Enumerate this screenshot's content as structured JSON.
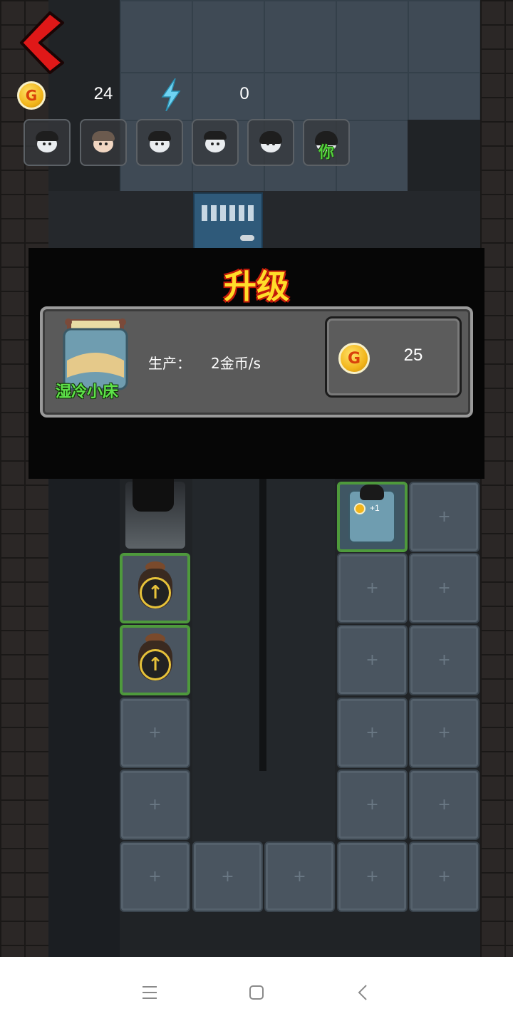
{
  "hud": {
    "gold": "24",
    "energy": "0",
    "coin_symbol": "G",
    "characters": [
      {
        "icon": "ghost-girl-icon"
      },
      {
        "icon": "old-woman-icon"
      },
      {
        "icon": "ghost-girl-icon"
      },
      {
        "icon": "boy-icon"
      },
      {
        "icon": "girl-icon"
      },
      {
        "icon": "player-girl-icon",
        "label": "你"
      }
    ]
  },
  "upgrade": {
    "title": "升级",
    "item_name": "湿冷小床",
    "produce_label": "生产：",
    "produce_value": "2金币/s",
    "cost": "25",
    "coin_symbol": "G"
  },
  "board": {
    "bed_reward": "+1"
  },
  "colors": {
    "accent_gold": "#f2b51b",
    "title_yellow": "#ffdd2a",
    "title_red": "#c41b0a",
    "name_green": "#5ee24a",
    "tile": "#4a5560"
  },
  "nav": {
    "buttons": [
      "menu-icon",
      "home-icon",
      "back-icon"
    ]
  }
}
